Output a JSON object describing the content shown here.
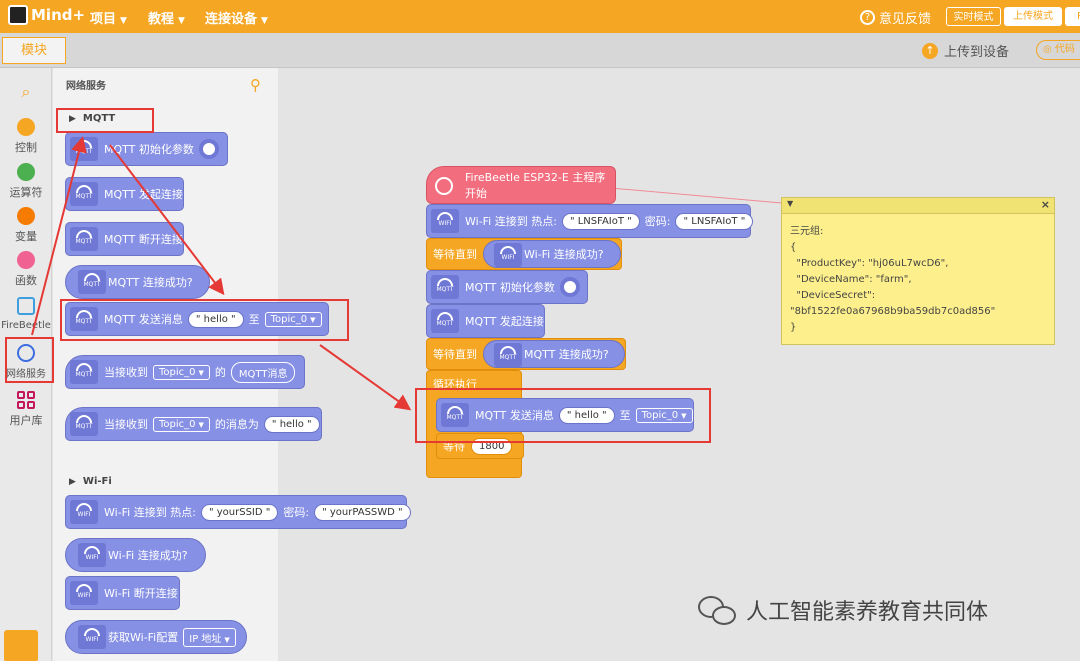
{
  "app": {
    "logo_text": "Mind+",
    "menus": [
      "项目",
      "教程",
      "连接设备"
    ],
    "feedback": "意见反馈",
    "modes": {
      "live": "实时模式",
      "upload": "上传模式",
      "python": "P"
    },
    "modules_tab": "模块",
    "upload_button": "上传到设备",
    "code_button": "代码"
  },
  "leftnav": {
    "items": [
      {
        "label": "控制",
        "color": "#f5a623"
      },
      {
        "label": "运算符",
        "color": "#4caf50"
      },
      {
        "label": "变量",
        "color": "#f57c00"
      },
      {
        "label": "函数",
        "color": "#f06292"
      },
      {
        "label": "FireBeetle"
      },
      {
        "label": "网络服务"
      },
      {
        "label": "用户库"
      }
    ]
  },
  "palette": {
    "title": "网络服务",
    "mqtt_category": "MQTT",
    "wifi_category": "Wi-Fi",
    "blocks": {
      "mqtt_init": "MQTT 初始化参数",
      "mqtt_connect": "MQTT 发起连接",
      "mqtt_disconnect": "MQTT 断开连接",
      "mqtt_connected": "MQTT 连接成功?",
      "mqtt_send": "MQTT 发送消息",
      "send_msg": "hello",
      "to": "至",
      "topic": "Topic_0",
      "when_recv": "当接收到",
      "of": "的",
      "mqtt_msg": "MQTT消息",
      "msg_is": "的消息为",
      "wifi_connect": "Wi-Fi 连接到 热点:",
      "ssid": "yourSSID",
      "password_label": "密码:",
      "passwd": "yourPASSWD",
      "wifi_connected": "Wi-Fi 连接成功?",
      "wifi_disconnect": "Wi-Fi 断开连接",
      "wifi_config": "获取Wi-Fi配置",
      "ip": "IP 地址",
      "wifi_icon": "WIFI",
      "mqtt_icon": "MQTT"
    }
  },
  "workspace": {
    "start": "FireBeetle ESP32-E 主程序开始",
    "wifi_connect": "Wi-Fi 连接到 热点:",
    "ssid": "LNSFAIoT",
    "password_label": "密码:",
    "passwd": "LNSFAIoT",
    "wait_until": "等待直到",
    "wifi_connected": "Wi-Fi 连接成功?",
    "mqtt_init": "MQTT 初始化参数",
    "mqtt_connect": "MQTT 发起连接",
    "mqtt_connected": "MQTT 连接成功?",
    "loop": "循环执行",
    "mqtt_send": "MQTT 发送消息",
    "send_msg": "hello",
    "to": "至",
    "topic": "Topic_0",
    "wait": "等待",
    "wait_value": "1800"
  },
  "note": {
    "text": "三元组:\n{\n  \"ProductKey\": \"hj06uL7wcD6\",\n  \"DeviceName\": \"farm\",\n  \"DeviceSecret\":\n\"8bf1522fe0a67968b9ba59db7c0ad856\"\n}"
  },
  "watermark": "人工智能素养教育共同体",
  "colors": {
    "accent": "#f5a623",
    "block": "#8690e4",
    "start": "#f26d7d",
    "annotation": "#e53935",
    "note": "#fdf08c"
  }
}
